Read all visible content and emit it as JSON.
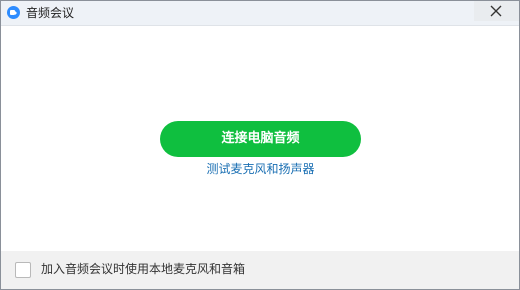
{
  "window": {
    "title": "音频会议",
    "close_icon": "close-icon",
    "app_icon": "zoom-camera-icon"
  },
  "main": {
    "connect_button_label": "连接电脑音频",
    "test_link_label": "测试麦克风和扬声器"
  },
  "footer": {
    "auto_join_label": "加入音频会议时使用本地麦克风和音箱",
    "auto_join_checked": false
  },
  "colors": {
    "accent_green": "#0fbf3f",
    "link_blue": "#1a6fb3",
    "app_icon_blue": "#2d8cff"
  }
}
